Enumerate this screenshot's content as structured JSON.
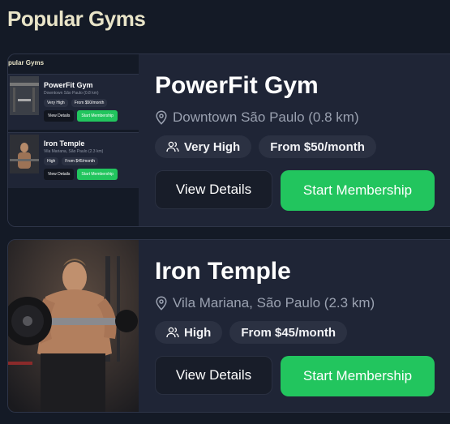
{
  "section": {
    "title": "Popular Gyms"
  },
  "gyms": [
    {
      "name": "PowerFit Gym",
      "location": "Downtown São Paulo (0.8 km)",
      "crowd": "Very High",
      "price": "From $50/month",
      "details_label": "View Details",
      "membership_label": "Start Membership"
    },
    {
      "name": "Iron Temple",
      "location": "Vila Mariana, São Paulo (2.3 km)",
      "crowd": "High",
      "price": "From $45/month",
      "details_label": "View Details",
      "membership_label": "Start Membership"
    }
  ],
  "preview": {
    "title": "pular Gyms",
    "gyms": [
      {
        "name": "PowerFit Gym",
        "location": "Downtown São Paulo (0.8 km)",
        "crowd": "Very High",
        "price": "From $50/month",
        "details_label": "View Details",
        "membership_label": "Start Membership"
      },
      {
        "name": "Iron Temple",
        "location": "Vila Mariana, São Paulo (2.3 km)",
        "crowd": "High",
        "price": "From $45/month",
        "details_label": "View Details",
        "membership_label": "Start Membership"
      }
    ]
  },
  "icons": {
    "location": "map-pin-icon",
    "crowd": "users-icon"
  },
  "colors": {
    "accent": "#22c55e",
    "background": "#141a26",
    "card": "#1f2536",
    "title": "#e9e4c8"
  }
}
